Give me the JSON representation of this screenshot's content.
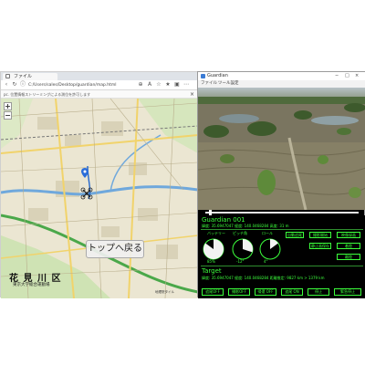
{
  "browser": {
    "tab_title": "ファイル",
    "url": "C:/Users/sales/Desktop/guardian/map.html",
    "info_text": "pc. 位置情報ストリーミングによる測位を許可します",
    "close_icon": "close-icon"
  },
  "map": {
    "back_button": "トップへ戻る",
    "district": "花 見 川 区",
    "district_sub": "東京大学総合運動場",
    "zoom_in": "+",
    "zoom_out": "−",
    "note": "地理院タイル"
  },
  "guardian": {
    "title": "Guardian",
    "menu": [
      "ファイル",
      "ツール設定"
    ],
    "win_controls": [
      "−",
      "□",
      "×"
    ],
    "drone": {
      "name": "Guardian 001",
      "coords": "緯度: 35.6947047   経度: 140.0468284   高度: 31 m"
    },
    "gauges": [
      {
        "label": "バッテリー",
        "value": "85%"
      },
      {
        "label": "ピッチ角",
        "value": "-12°"
      },
      {
        "label": "ロール",
        "value": "4°"
      }
    ],
    "gauge_levels": [
      0.85,
      0.3,
      0.15
    ],
    "side_buttons": [
      "自動追尾",
      "撮影開始",
      "映像録画",
      "静止画保存",
      "着陸",
      "離陸"
    ],
    "target": {
      "title": "Target",
      "info": "緯度: 35.6947047   経度: 140.0468284   距離推定: 9827 km > 1379 km"
    },
    "bottom_buttons": [
      "追尾OFF",
      "撮影OFF",
      "帰還 OFF",
      "追尾 ON",
      "停止",
      "緊急停止"
    ]
  },
  "colors": {
    "accent": "#3cff3c",
    "map_bg": "#e9e4cf",
    "panel_bg": "#000000"
  }
}
